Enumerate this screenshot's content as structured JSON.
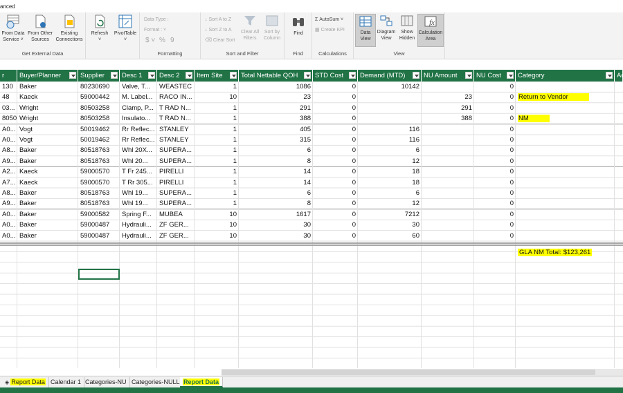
{
  "window": {
    "title_fragment": "anced"
  },
  "ribbon": {
    "groups": [
      {
        "label": "Get External Data",
        "buttons": [
          {
            "label": "From Data Service",
            "icon": "database-icon"
          },
          {
            "label": "From Other Sources",
            "icon": "data-sources-icon"
          },
          {
            "label": "Existing Connections",
            "icon": "connections-icon"
          }
        ]
      },
      {
        "label": "",
        "buttons": [
          {
            "label": "Refresh",
            "icon": "refresh-icon"
          },
          {
            "label": "PivotTable",
            "icon": "pivot-table-icon"
          }
        ]
      },
      {
        "label": "Formatting",
        "items": [
          "Data Type :",
          "Format :",
          "$",
          "%",
          "9"
        ]
      },
      {
        "label": "Sort and Filter",
        "items": [
          "Sort A to Z",
          "Sort Z to A",
          "Clear Sort",
          "Clear All Filters",
          "Sort by Column"
        ]
      },
      {
        "label": "Find",
        "buttons": [
          {
            "label": "Find",
            "icon": "binoculars-icon"
          }
        ]
      },
      {
        "label": "Calculations",
        "items": [
          "AutoSum",
          "Create KPI"
        ]
      },
      {
        "label": "View",
        "buttons": [
          {
            "label": "Data View",
            "icon": "grid-icon",
            "selected": true
          },
          {
            "label": "Diagram View",
            "icon": "diagram-icon"
          },
          {
            "label": "Show Hidden",
            "icon": "show-hidden-icon"
          },
          {
            "label": "Calculation Area",
            "icon": "calc-area-icon",
            "selected": true
          }
        ]
      }
    ]
  },
  "columns": [
    "r",
    "Buyer/Planner",
    "Supplier",
    "Desc 1",
    "Desc 2",
    "Item Site",
    "Total Nettable QOH",
    "STD Cost",
    "Demand (MTD)",
    "NU Amount",
    "NU Cost",
    "Category",
    "Ad"
  ],
  "rows": [
    [
      "130",
      "Baker",
      "80230690",
      "Valve, T...",
      "WEASTEC",
      "1",
      "1086",
      "0",
      "10142",
      "",
      "0",
      ""
    ],
    [
      "48",
      "Kaeck",
      "59000442",
      "M. Label...",
      "RACO IN...",
      "10",
      "23",
      "0",
      "",
      "23",
      "0",
      "Return to Vendor"
    ],
    [
      "03...",
      "Wright",
      "80503258",
      "Clamp, P...",
      "T RAD N...",
      "1",
      "291",
      "0",
      "",
      "291",
      "0",
      ""
    ],
    [
      "8050",
      "Wright",
      "80503258",
      "Insulato...",
      "T RAD N...",
      "1",
      "388",
      "0",
      "",
      "388",
      "0",
      "NM"
    ],
    [
      "A0...",
      "Vogt",
      "50019462",
      "Rr Reflec...",
      "STANLEY",
      "1",
      "405",
      "0",
      "116",
      "",
      "0",
      ""
    ],
    [
      "A0...",
      "Vogt",
      "50019462",
      "Rr Reflec...",
      "STANLEY",
      "1",
      "315",
      "0",
      "116",
      "",
      "0",
      ""
    ],
    [
      "A8...",
      "Baker",
      "80518763",
      "Whl 20X...",
      "SUPERA...",
      "1",
      "6",
      "0",
      "6",
      "",
      "0",
      ""
    ],
    [
      "A9...",
      "Baker",
      "80518763",
      " Whl 20...",
      "SUPERA...",
      "1",
      "8",
      "0",
      "12",
      "",
      "0",
      ""
    ],
    [
      "A2...",
      "Kaeck",
      "59000570",
      "T Fr 245...",
      "PIRELLI",
      "1",
      "14",
      "0",
      "18",
      "",
      "0",
      ""
    ],
    [
      "A7...",
      "Kaeck",
      "59000570",
      "T Rr 305...",
      "PIRELLI",
      "1",
      "14",
      "0",
      "18",
      "",
      "0",
      ""
    ],
    [
      "A8...",
      "Baker",
      "80518763",
      " Whl 19...",
      "SUPERA...",
      "1",
      "6",
      "0",
      "6",
      "",
      "0",
      ""
    ],
    [
      "A9...",
      "Baker",
      "80518763",
      " Whl 19...",
      "SUPERA...",
      "1",
      "8",
      "0",
      "12",
      "",
      "0",
      ""
    ],
    [
      "A0...",
      "Baker",
      "59000582",
      "Spring F...",
      "MUBEA",
      "10",
      "1617",
      "0",
      "7212",
      "",
      "0",
      ""
    ],
    [
      "A0...",
      "Baker",
      "59000487",
      "Hydrauli...",
      "ZF GER...",
      "10",
      "30",
      "0",
      "30",
      "",
      "0",
      ""
    ],
    [
      "A0...",
      "Baker",
      "59000487",
      "Hydrauli...",
      "ZF GER...",
      "10",
      "30",
      "0",
      "60",
      "",
      "0",
      ""
    ]
  ],
  "highlight_cells": [
    "1-11",
    "3-11"
  ],
  "calc_area": {
    "total_label": "GLA NM Total: $123,261"
  },
  "sheet_tabs": [
    {
      "label": "Report Data",
      "highlight": true,
      "icon": true
    },
    {
      "label": "Calendar 1"
    },
    {
      "label": "Categories-NU"
    },
    {
      "label": "Categories-NULL"
    },
    {
      "label": "Report Data",
      "highlight": true,
      "active": true
    }
  ],
  "colors": {
    "accent": "#217346",
    "highlight": "#ffff00"
  }
}
